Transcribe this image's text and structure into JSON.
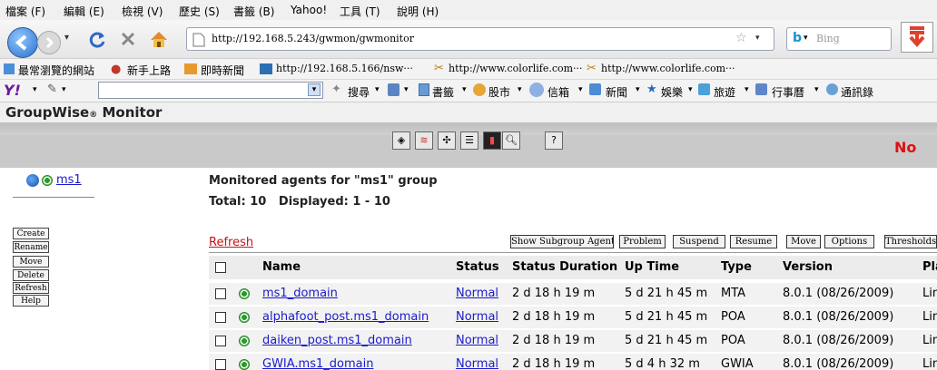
{
  "browser": {
    "menu": [
      "檔案 (F)",
      "編輯 (E)",
      "檢視 (V)",
      "歷史 (S)",
      "書籤 (B)",
      "Yahoo!",
      "工具 (T)",
      "說明 (H)"
    ],
    "url": "http://192.168.5.243/gwmon/gwmonitor",
    "search_placeholder": "Bing",
    "bookmarks": [
      "最常瀏覽的網站",
      "新手上路",
      "即時新聞",
      "http://192.168.5.166/nsw···",
      "http://www.colorlife.com···",
      "http://www.colorlife.com···"
    ],
    "yahoo": {
      "logo": "Y!",
      "search_label": "搜尋",
      "items": [
        "書籤",
        "股市",
        "信箱",
        "新聞",
        "娛樂",
        "旅遊",
        "行事曆",
        "通訊錄"
      ]
    }
  },
  "app": {
    "title": "GroupWise",
    "title_suffix": "Monitor",
    "brand_fragment": "No"
  },
  "sidebar": {
    "group_name": "ms1",
    "buttons": [
      "Create",
      "Rename",
      "Move",
      "Delete",
      "Refresh",
      "Help"
    ]
  },
  "main": {
    "heading": "Monitored agents for \"ms1\" group",
    "totals": "Total: 10   Displayed: 1 - 10",
    "refresh": "Refresh",
    "actions": [
      "Show Subgroup Agents",
      "Problem",
      "Suspend",
      "Resume",
      "Move",
      "Options",
      "Thresholds"
    ],
    "columns": [
      "Name",
      "Status",
      "Status Duration",
      "Up Time",
      "Type",
      "Version",
      "Pla"
    ],
    "rows": [
      {
        "name": "ms1_domain",
        "status": "Normal",
        "duration": "2 d 18 h 19 m",
        "uptime": "5 d 21 h 45 m",
        "type": "MTA",
        "version": "8.0.1 (08/26/2009)",
        "platform": "Lin"
      },
      {
        "name": "alphafoot_post.ms1_domain",
        "status": "Normal",
        "duration": "2 d 18 h 19 m",
        "uptime": "5 d 21 h 45 m",
        "type": "POA",
        "version": "8.0.1 (08/26/2009)",
        "platform": "Lin"
      },
      {
        "name": "daiken_post.ms1_domain",
        "status": "Normal",
        "duration": "2 d 18 h 19 m",
        "uptime": "5 d 21 h 45 m",
        "type": "POA",
        "version": "8.0.1 (08/26/2009)",
        "platform": "Lin"
      },
      {
        "name": "GWIA.ms1_domain",
        "status": "Normal",
        "duration": "2 d 18 h 19 m",
        "uptime": "5 d 4 h 32 m",
        "type": "GWIA",
        "version": "8.0.1 (08/26/2009)",
        "platform": "Lin"
      }
    ]
  }
}
